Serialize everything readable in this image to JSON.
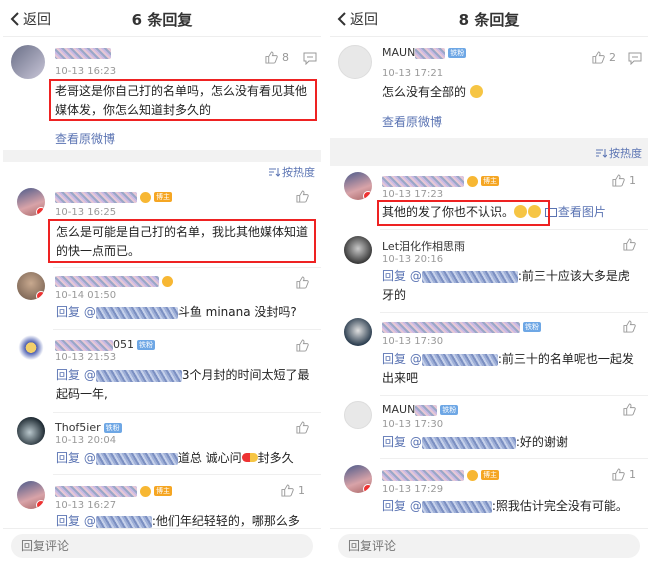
{
  "left": {
    "nav": {
      "back": "返回",
      "title": "6 条回复"
    },
    "original": {
      "time": "10-13 16:23",
      "likes": "8",
      "content": "老哥这是你自己打的名单吗，怎么没有看见其他媒体发，你怎么知道封多久的",
      "view_link": "查看原微博"
    },
    "sort_label": "按热度",
    "comments": [
      {
        "time": "10-13 16:25",
        "tag": "博主",
        "content": "怎么是可能是自己打的名单，我比其他媒体知道的快一点而已。"
      },
      {
        "time": "10-14 01:50",
        "content_prefix": "回复 @",
        "content_suffix": "斗鱼 minana 没封吗?"
      },
      {
        "time": "10-13 21:53",
        "tag": "铁粉",
        "name_suffix": "051",
        "content_prefix": "回复 @",
        "content_suffix": "3个月封的时间太短了最起码一年,"
      },
      {
        "name": "Thof5ier",
        "time": "10-13 20:04",
        "tag": "铁粉",
        "content_prefix": "回复 @",
        "content_suffix": "道总 诚心问",
        "content_tail": "封多久"
      },
      {
        "time": "10-13 16:27",
        "tag": "博主",
        "likes": "1",
        "content_prefix": "回复 @",
        "content_suffix": ":他们年纪轻轻的，哪那么多"
      }
    ],
    "reply_placeholder": "回复评论"
  },
  "right": {
    "nav": {
      "back": "返回",
      "title": "8 条回复"
    },
    "original": {
      "name": "MAUN",
      "tag": "铁粉",
      "time": "10-13 17:21",
      "likes": "2",
      "content": "怎么没有全部的",
      "view_link": "查看原微博"
    },
    "sort_label": "按热度",
    "comments": [
      {
        "time": "10-13 17:23",
        "tag": "博主",
        "likes": "1",
        "content": "其他的发了你也不认识。",
        "view_image": "查看图片"
      },
      {
        "name": "Let泪化作相思雨",
        "time": "10-13 20:16",
        "content_prefix": "回复 @",
        "content_suffix": ":前三十应该大多是虎牙的"
      },
      {
        "time": "10-13 17:30",
        "tag": "铁粉",
        "content_prefix": "回复 @",
        "content_suffix": ":前三十的名单呢也一起发出来吧"
      },
      {
        "name": "MAUN",
        "time": "10-13 17:30",
        "tag": "铁粉",
        "content_prefix": "回复 @",
        "content_suffix": ":好的谢谢"
      },
      {
        "time": "10-13 17:29",
        "tag": "博主",
        "likes": "1",
        "content_prefix": "回复 @",
        "content_suffix": ":照我估计完全没有可能。"
      }
    ],
    "reply_placeholder": "回复评论"
  },
  "colors": {
    "link": "#5b74b3",
    "highlight_box": "#e22222",
    "fan_tag": "#6ea7e5",
    "owner_tag": "#f5a623"
  }
}
